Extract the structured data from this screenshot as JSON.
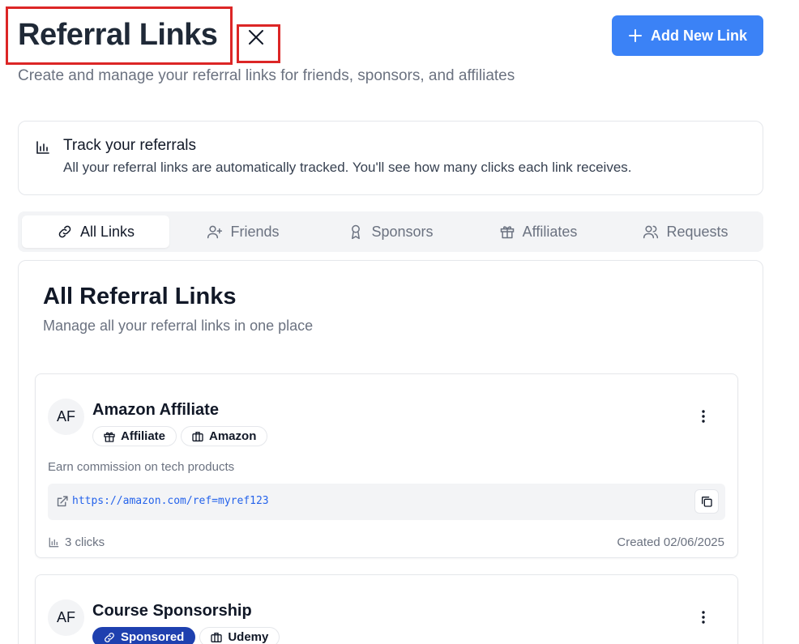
{
  "header": {
    "title": "Referral Links",
    "subtitle": "Create and manage your referral links for friends, sponsors, and affiliates",
    "add_button": "Add New Link"
  },
  "info": {
    "title": "Track your referrals",
    "text": "All your referral links are automatically tracked. You'll see how many clicks each link receives."
  },
  "tabs": [
    {
      "label": "All Links",
      "icon": "link-icon",
      "active": true
    },
    {
      "label": "Friends",
      "icon": "user-plus-icon",
      "active": false
    },
    {
      "label": "Sponsors",
      "icon": "award-icon",
      "active": false
    },
    {
      "label": "Affiliates",
      "icon": "gift-icon",
      "active": false
    },
    {
      "label": "Requests",
      "icon": "users-icon",
      "active": false
    }
  ],
  "main": {
    "title": "All Referral Links",
    "subtitle": "Manage all your referral links in one place"
  },
  "links": [
    {
      "avatar": "AF",
      "title": "Amazon Affiliate",
      "badges": [
        {
          "label": "Affiliate",
          "icon": "gift-icon",
          "style": "outline"
        },
        {
          "label": "Amazon",
          "icon": "briefcase-icon",
          "style": "outline"
        }
      ],
      "description": "Earn commission on tech products",
      "url": "https://amazon.com/ref=myref123",
      "clicks": "3 clicks",
      "created": "Created 02/06/2025"
    },
    {
      "avatar": "AF",
      "title": "Course Sponsorship",
      "badges": [
        {
          "label": "Sponsored",
          "icon": "link-icon",
          "style": "filled",
          "color": "#1e40af"
        },
        {
          "label": "Udemy",
          "icon": "briefcase-icon",
          "style": "outline"
        }
      ]
    }
  ],
  "colors": {
    "primary": "#3b82f6",
    "highlight_border": "#dc2626",
    "sponsored_badge": "#1e40af",
    "link_text": "#2563eb"
  }
}
